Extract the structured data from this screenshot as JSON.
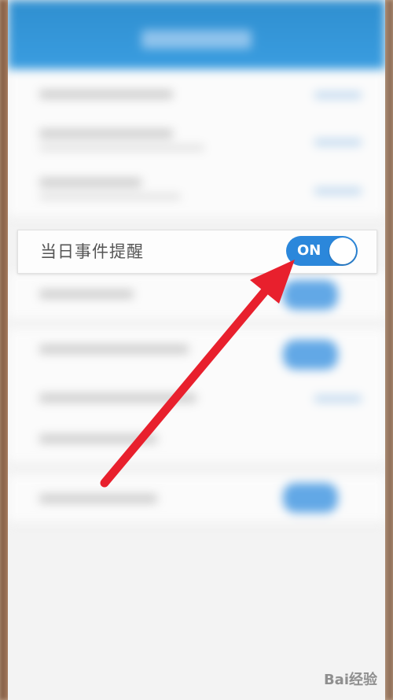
{
  "setting_row": {
    "label": "当日事件提醒"
  },
  "toggle": {
    "state_label": "ON",
    "on": true,
    "color": "#2b87db"
  },
  "annotation": {
    "color": "#e8202d"
  },
  "watermark": {
    "text": "Bai经验"
  }
}
